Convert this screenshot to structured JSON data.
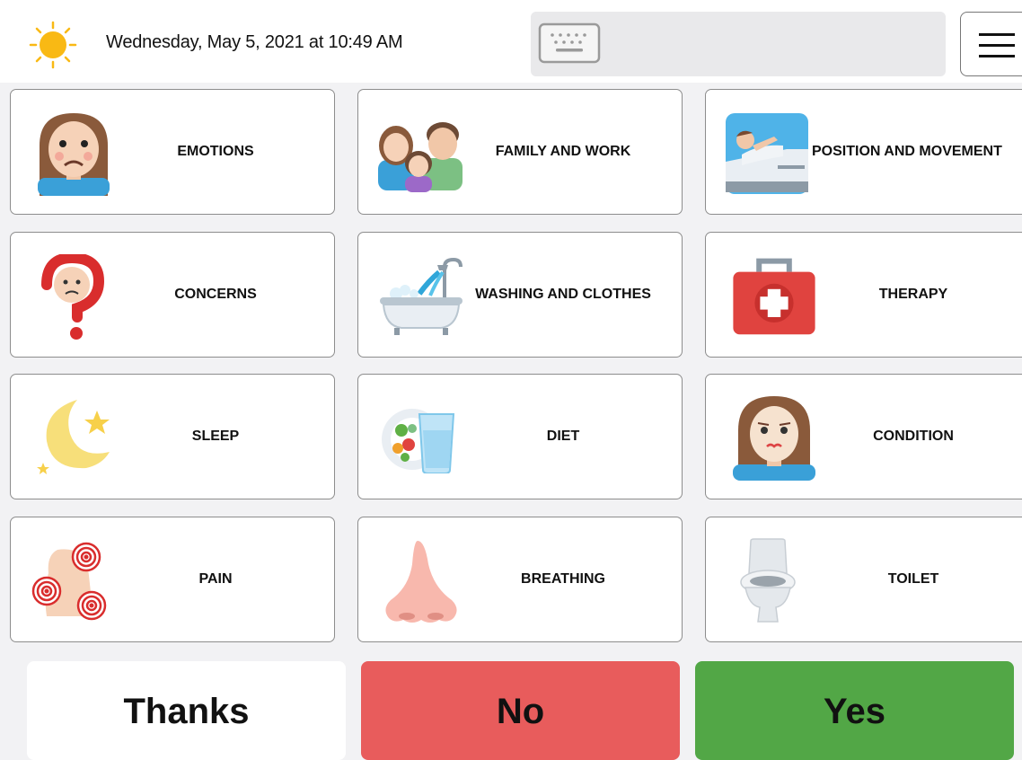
{
  "header": {
    "datetime": "Wednesday, May 5, 2021 at 10:49 AM",
    "weather_icon": "sun-icon",
    "keyboard_icon": "keyboard-icon",
    "menu_icon": "hamburger-menu-icon"
  },
  "tiles": [
    {
      "label": "EMOTIONS",
      "icon": "sad-face-icon"
    },
    {
      "label": "FAMILY AND WORK",
      "icon": "family-icon"
    },
    {
      "label": "POSITION AND MOVEMENT",
      "icon": "hospital-bed-icon"
    },
    {
      "label": "CONCERNS",
      "icon": "question-mark-icon"
    },
    {
      "label": "WASHING AND CLOTHES",
      "icon": "bathtub-icon"
    },
    {
      "label": "THERAPY",
      "icon": "first-aid-kit-icon"
    },
    {
      "label": "SLEEP",
      "icon": "moon-icon"
    },
    {
      "label": "DIET",
      "icon": "food-plate-icon"
    },
    {
      "label": "CONDITION",
      "icon": "sick-face-icon"
    },
    {
      "label": "PAIN",
      "icon": "pain-points-icon"
    },
    {
      "label": "BREATHING",
      "icon": "nose-icon"
    },
    {
      "label": "TOILET",
      "icon": "toilet-icon"
    }
  ],
  "quick_replies": {
    "thanks": "Thanks",
    "no": "No",
    "yes": "Yes"
  },
  "colors": {
    "no": "#e85c5c",
    "yes": "#52a746",
    "thanks": "#ffffff",
    "sun": "#f9b914"
  }
}
